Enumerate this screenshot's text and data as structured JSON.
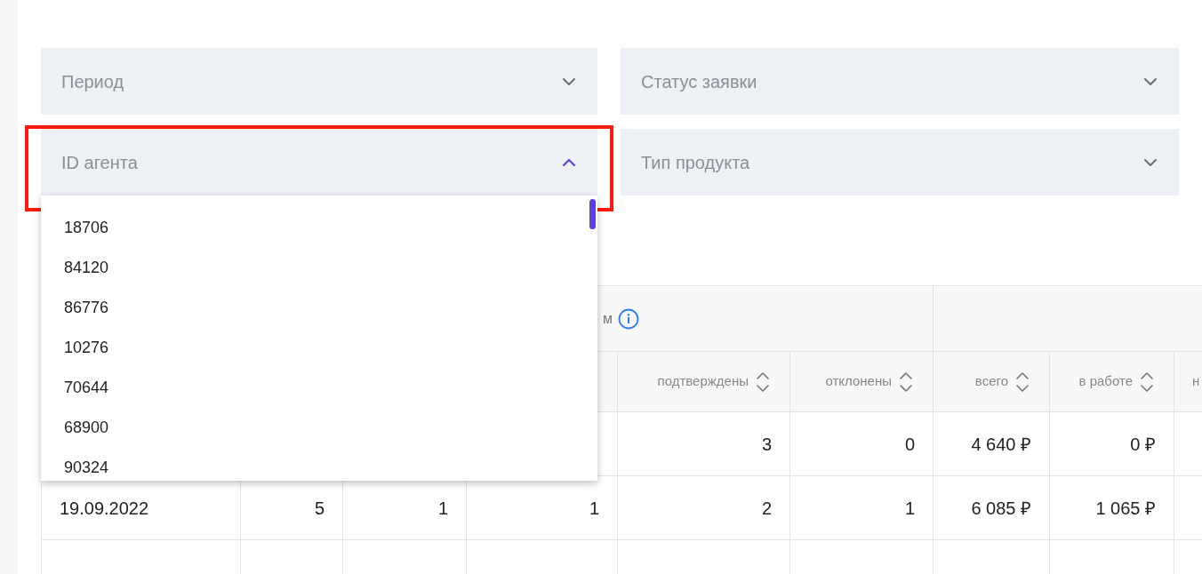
{
  "filters": [
    {
      "label": "Период",
      "expanded": false,
      "highlighted": false
    },
    {
      "label": "Статус заявки",
      "expanded": false,
      "highlighted": false
    },
    {
      "label": "ID агента",
      "expanded": true,
      "highlighted": true
    },
    {
      "label": "Тип продукта",
      "expanded": false,
      "highlighted": false
    }
  ],
  "dropdown": {
    "options": [
      "18706",
      "84120",
      "86776",
      "10276",
      "70644",
      "68900",
      "90324"
    ]
  },
  "table": {
    "group_headers": [
      {
        "text": "м",
        "info_icon": true
      }
    ],
    "columns": [
      null,
      null,
      null,
      null,
      {
        "label": "подтверждены",
        "sortable": true
      },
      {
        "label": "отклонены",
        "sortable": true
      },
      {
        "label": "всего",
        "sortable": true
      },
      {
        "label": "в работе",
        "sortable": true
      },
      {
        "label": "н"
      }
    ],
    "rows": [
      [
        null,
        null,
        null,
        null,
        "3",
        "0",
        "4 640 ₽",
        "0 ₽"
      ],
      [
        "19.09.2022",
        "5",
        "1",
        "1",
        "2",
        "1",
        "6 085 ₽",
        "1 065 ₽"
      ]
    ]
  }
}
